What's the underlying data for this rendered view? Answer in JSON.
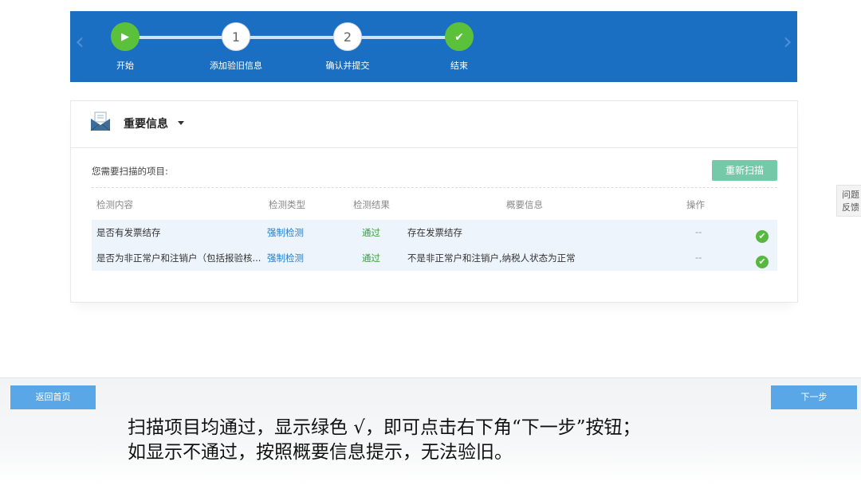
{
  "wizard": {
    "steps": [
      {
        "label": "开始",
        "icon": "play-icon",
        "marker": "▶",
        "state": "active"
      },
      {
        "label": "添加验旧信息",
        "marker": "1",
        "state": "pending"
      },
      {
        "label": "确认并提交",
        "marker": "2",
        "state": "pending"
      },
      {
        "label": "结束",
        "icon": "check-icon",
        "marker": "✔",
        "state": "done"
      }
    ],
    "prev_icon": "chevron-left-icon",
    "next_icon": "chevron-right-icon",
    "prev_glyph": "‹",
    "next_glyph": "›"
  },
  "panel": {
    "title": "重要信息",
    "icon": "envelope-icon",
    "scan_label": "您需要扫描的项目:",
    "rescan_button": "重新扫描",
    "columns": [
      "检测内容",
      "检测类型",
      "检测结果",
      "概要信息",
      "操作"
    ],
    "rows": [
      {
        "content": "是否有发票结存",
        "type": "强制检测",
        "result": "通过",
        "summary": "存在发票结存",
        "ops": "--",
        "status_icon": "check-circle-icon"
      },
      {
        "content": "是否为非正常户和注销户（包括报验核...",
        "type": "强制检测",
        "result": "通过",
        "summary": "不是非正常户和注销户,纳税人状态为正常",
        "ops": "--",
        "status_icon": "check-circle-icon"
      }
    ]
  },
  "feedback": {
    "line1": "问题",
    "line2": "反馈"
  },
  "footer": {
    "home_button": "返回首页",
    "next_button": "下一步"
  },
  "caption": {
    "line1": "扫描项目均通过，显示绿色 √，即可点击右下角“下一步”按钮；",
    "line2": "如显示不通过，按照概要信息提示，无法验旧。"
  },
  "colors": {
    "banner": "#1b6fc3",
    "success": "#5cc13a",
    "rescan": "#75c8a8",
    "button": "#5aa7e8"
  }
}
